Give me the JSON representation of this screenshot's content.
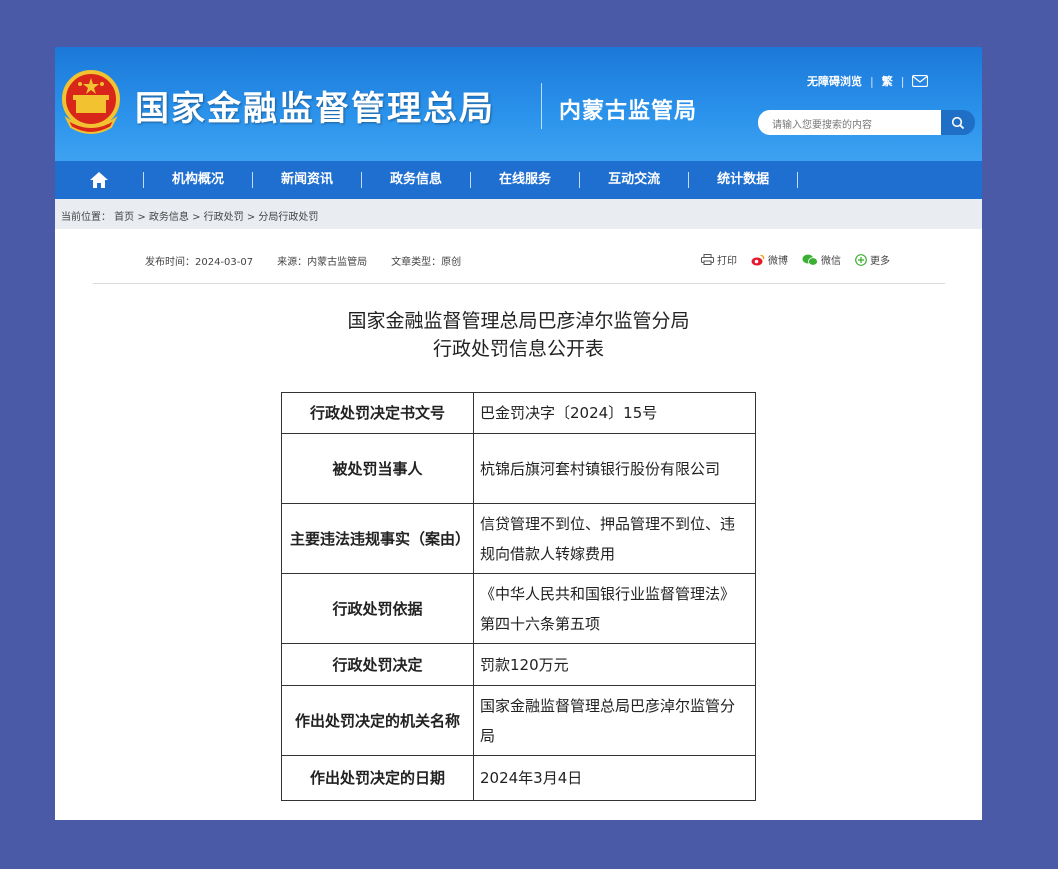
{
  "header": {
    "site_title": "国家金融监督管理总局",
    "sub_title": "内蒙古监管局",
    "top_links": [
      "无障碍浏览",
      "繁"
    ],
    "search_placeholder": "请输入您要搜索的内容"
  },
  "nav": {
    "items": [
      "机构概况",
      "新闻资讯",
      "政务信息",
      "在线服务",
      "互动交流",
      "统计数据"
    ]
  },
  "breadcrumb": "当前位置： 首页 > 政务信息 > 行政处罚 > 分局行政处罚",
  "meta": {
    "publish_time": "发布时间：2024-03-07",
    "source": "来源：内蒙古监管局",
    "doc_type": "文章类型：原创"
  },
  "share": {
    "print": "打印",
    "weibo": "微博",
    "wechat": "微信",
    "more": "更多"
  },
  "document": {
    "title_line1": "国家金融监督管理总局巴彦淖尔监管分局",
    "title_line2": "行政处罚信息公开表"
  },
  "table": {
    "rows": [
      {
        "key": "行政处罚决定书文号",
        "value": "巴金罚决字〔2024〕15号"
      },
      {
        "key": "被处罚当事人",
        "value": "杭锦后旗河套村镇银行股份有限公司"
      },
      {
        "key": "主要违法违规事实（案由）",
        "value": "信贷管理不到位、押品管理不到位、违规向借款人转嫁费用"
      },
      {
        "key": "行政处罚依据",
        "value": "《中华人民共和国银行业监督管理法》第四十六条第五项"
      },
      {
        "key": "行政处罚决定",
        "value": "罚款120万元"
      },
      {
        "key": "作出处罚决定的机关名称",
        "value": "国家金融监督管理总局巴彦淖尔监管分局"
      },
      {
        "key": "作出处罚决定的日期",
        "value": "2024年3月4日"
      }
    ]
  },
  "colors": {
    "background": "#4a5aa6",
    "header_blue": "#2b93ec",
    "nav_blue": "#1e6fd0"
  }
}
